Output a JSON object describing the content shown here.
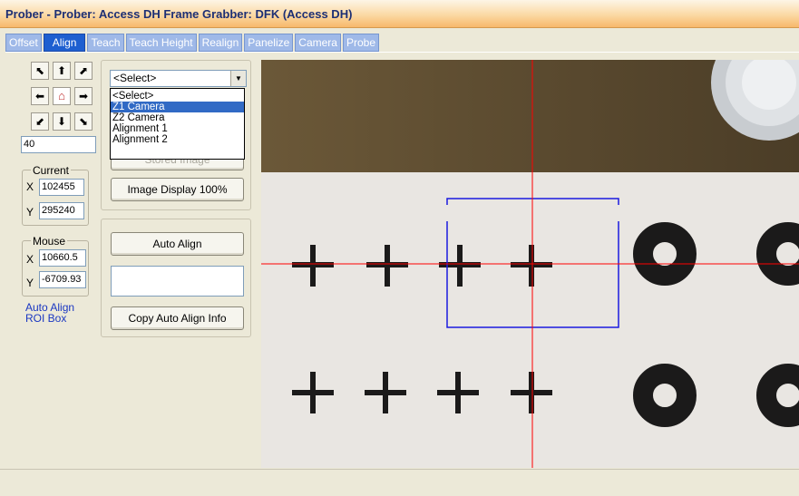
{
  "window": {
    "title": "Prober - Prober: Access DH Frame Grabber: DFK (Access DH)"
  },
  "tabs": [
    {
      "label": "Offset",
      "active": false
    },
    {
      "label": "Align",
      "active": true
    },
    {
      "label": "Teach",
      "active": false
    },
    {
      "label": "Teach Height",
      "active": false
    },
    {
      "label": "Realign",
      "active": false
    },
    {
      "label": "Panelize",
      "active": false
    },
    {
      "label": "Camera",
      "active": false
    },
    {
      "label": "Probe",
      "active": false
    }
  ],
  "jog": {
    "buttons": [
      {
        "name": "jog-up-left-button",
        "glyph": "⬉"
      },
      {
        "name": "jog-up-button",
        "glyph": "⬆"
      },
      {
        "name": "jog-up-right-button",
        "glyph": "⬈"
      },
      {
        "name": "jog-left-button",
        "glyph": "⬅"
      },
      {
        "name": "home-button",
        "glyph": "⌂"
      },
      {
        "name": "jog-right-button",
        "glyph": "➡"
      },
      {
        "name": "jog-down-left-button",
        "glyph": "⬋"
      },
      {
        "name": "jog-down-button",
        "glyph": "⬇"
      },
      {
        "name": "jog-down-right-button",
        "glyph": "⬊"
      }
    ],
    "step": "40"
  },
  "current": {
    "label": "Current",
    "x_label": "X",
    "y_label": "Y",
    "x": "102455",
    "y": "295240"
  },
  "mouse": {
    "label": "Mouse",
    "x_label": "X",
    "y_label": "Y",
    "x": "10660.5",
    "y": "-6709.93"
  },
  "roi_link": {
    "line1": "Auto Align",
    "line2": "ROI Box"
  },
  "camera_select": {
    "value": "<Select>",
    "options": [
      "<Select>",
      "Z1 Camera",
      "Z2 Camera",
      "Alignment 1",
      "Alignment 2"
    ],
    "highlighted": 1
  },
  "buttons": {
    "stored_image": "Stored Image",
    "image_display": "Image Display 100%",
    "auto_align": "Auto Align",
    "copy_info": "Copy Auto Align Info"
  },
  "auto_align_textbox": "",
  "camera_view": {
    "crosshair_color": "#ff0000",
    "roi_color": "#0000dd"
  },
  "icons": {
    "home": "house-icon",
    "dropdown": "chevron-down-icon"
  }
}
